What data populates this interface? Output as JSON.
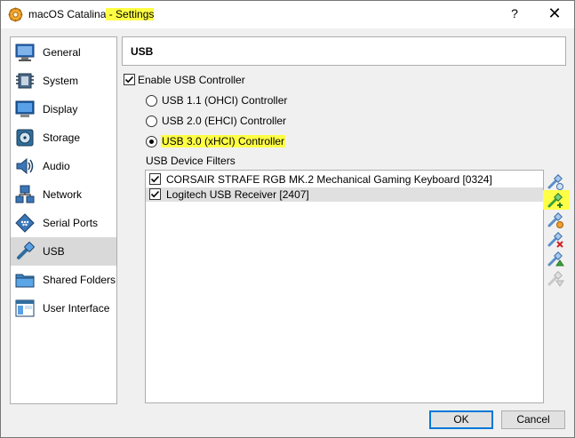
{
  "window": {
    "title_prefix": "macOS Catalina",
    "title_suffix": " - Settings",
    "help_glyph": "?",
    "close_glyph": "✕"
  },
  "sidebar": {
    "items": [
      {
        "label": "General",
        "icon": "general-icon"
      },
      {
        "label": "System",
        "icon": "system-icon"
      },
      {
        "label": "Display",
        "icon": "display-icon"
      },
      {
        "label": "Storage",
        "icon": "storage-icon"
      },
      {
        "label": "Audio",
        "icon": "audio-icon"
      },
      {
        "label": "Network",
        "icon": "network-icon"
      },
      {
        "label": "Serial Ports",
        "icon": "serial-ports-icon"
      },
      {
        "label": "USB",
        "icon": "usb-icon",
        "selected": true
      },
      {
        "label": "Shared Folders",
        "icon": "shared-folders-icon"
      },
      {
        "label": "User Interface",
        "icon": "user-interface-icon"
      }
    ]
  },
  "main": {
    "section_title": "USB",
    "enable_usb_label": "Enable USB Controller",
    "enable_usb_checked": true,
    "controllers": [
      {
        "label": "USB 1.1 (OHCI) Controller",
        "selected": false
      },
      {
        "label": "USB 2.0 (EHCI) Controller",
        "selected": false
      },
      {
        "label": "USB 3.0 (xHCI) Controller",
        "selected": true
      }
    ],
    "filters_label": "USB Device Filters",
    "filters": [
      {
        "label": "CORSAIR STRAFE RGB MK.2 Mechanical Gaming Keyboard [0324]",
        "checked": true
      },
      {
        "label": "Logitech USB Receiver [2407]",
        "checked": true,
        "selected": true
      }
    ],
    "toolbar": [
      {
        "icon": "add-empty-filter-icon"
      },
      {
        "icon": "add-filter-from-device-icon",
        "highlighted": true
      },
      {
        "icon": "edit-filter-icon"
      },
      {
        "icon": "remove-filter-icon"
      },
      {
        "icon": "move-filter-up-icon"
      },
      {
        "icon": "move-filter-down-icon",
        "disabled": true
      }
    ]
  },
  "buttons": {
    "ok": "OK",
    "cancel": "Cancel"
  },
  "colors": {
    "highlight": "#ffff45",
    "selection": "#d9d9d9",
    "accent": "#0078d7"
  }
}
